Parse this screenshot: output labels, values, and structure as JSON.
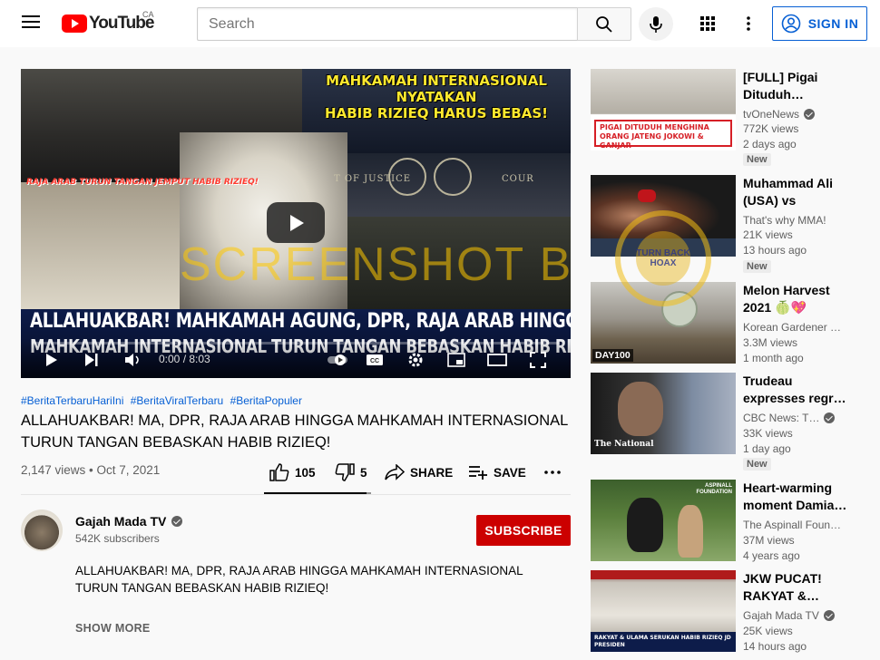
{
  "header": {
    "logo_text": "YouTube",
    "country_code": "CA",
    "search_placeholder": "Search",
    "signin_label": "SIGN IN"
  },
  "player": {
    "overlay_title_line1": "MAHKAMAH INTERNASIONAL NYATAKAN",
    "overlay_title_line2": "HABIB RIZIEQ HARUS BEBAS!",
    "raja_caption": "RAJA ARAB TURUN TANGAN JEMPUT HABIB RIZIEQ!",
    "justice_text": "T OF JUSTICE",
    "court_text": "COUR",
    "headline_line1": "ALLAHUAKBAR! MAHKAMAH AGUNG, DPR, RAJA ARAB HINGGA",
    "headline_line2": "MAHKAMAH INTERNASIONAL TURUN TANGAN BEBASKAN HABIB RIZIEQ!",
    "watermark": "SCREENSHOT BY",
    "time": "0:00 / 8:03",
    "progress": 0
  },
  "video": {
    "hashtags": [
      "#BeritaTerbaruHariIni",
      "#BeritaViralTerbaru",
      "#BeritaPopuler"
    ],
    "title": "ALLAHUAKBAR! MA, DPR, RAJA ARAB HINGGA MAHKAMAH INTERNASIONAL TURUN TANGAN BEBASKAN HABIB RIZIEQ!",
    "views": "2,147 views",
    "date": "Oct 7, 2021",
    "views_line": "2,147 views • Oct 7, 2021",
    "likes": "105",
    "dislikes": "5",
    "share_label": "SHARE",
    "save_label": "SAVE"
  },
  "channel": {
    "name": "Gajah Mada TV",
    "subscribers": "542K subscribers",
    "subscribe_label": "SUBSCRIBE"
  },
  "description": {
    "text": "ALLAHUAKBAR! MA, DPR, RAJA ARAB HINGGA MAHKAMAH INTERNASIONAL TURUN TANGAN BEBASKAN HABIB RIZIEQ!",
    "show_more": "SHOW MORE"
  },
  "recommendations": [
    {
      "title": "[FULL] Pigai Dituduh…",
      "channel": "tvOneNews",
      "verified": true,
      "views": "772K views",
      "age": "2 days ago",
      "badge": "New",
      "thumb_caption": "PIGAI DITUDUH MENGHINA ORANG JATENG JOKOWI & GANJAR"
    },
    {
      "title": "Muhammad Ali (USA) vs Earnie…",
      "channel": "That's why MMA!",
      "verified": false,
      "views": "21K views",
      "age": "13 hours ago",
      "badge": "New"
    },
    {
      "title": "Melon Harvest 2021",
      "title_emoji": "🍈💖",
      "channel": "Korean Gardener …",
      "verified": false,
      "views": "3.3M views",
      "age": "1 month ago",
      "thumb_label": "DAY100"
    },
    {
      "title": "Trudeau expresses regr…",
      "channel": "CBC News: T…",
      "verified": true,
      "views": "33K views",
      "age": "1 day ago",
      "badge": "New",
      "thumb_label": "The National"
    },
    {
      "title": "Heart-warming moment Damia…",
      "channel": "The Aspinall Foun…",
      "verified": false,
      "views": "37M views",
      "age": "4 years ago",
      "thumb_label": "ASPINALL FOUNDATION"
    },
    {
      "title": "JKW PUCAT! RAKYAT &…",
      "channel": "Gajah Mada TV",
      "verified": true,
      "views": "25K views",
      "age": "14 hours ago",
      "thumb_caption": "RAKYAT & ULAMA SERUKAN HABIB RIZIEQ JD PRESIDEN"
    }
  ],
  "stamp": {
    "text": "TURN BACK HOAX"
  },
  "colors": {
    "brand_red": "#ff0000",
    "subscribe_red": "#cc0000",
    "link_blue": "#065fd4",
    "overlay_yellow": "#ffe92e"
  }
}
